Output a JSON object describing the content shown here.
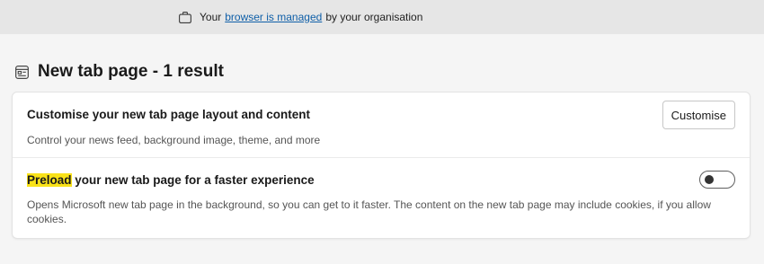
{
  "managed_bar": {
    "prefix": "Your",
    "link": "browser is managed",
    "suffix": "by your organisation",
    "icon": "briefcase-icon"
  },
  "section": {
    "title": "New tab page - 1 result",
    "icon": "new-tab-page-icon"
  },
  "settings": {
    "customise": {
      "title": "Customise your new tab page layout and content",
      "description": "Control your news feed, background image, theme, and more",
      "button_label": "Customise"
    },
    "preload": {
      "title_highlight": "Preload",
      "title_rest": " your new tab page for a faster experience",
      "description": "Opens Microsoft new tab page in the background, so you can get to it faster. The content on the new tab page may include cookies, if you allow cookies.",
      "enabled": false
    }
  },
  "colors": {
    "link": "#0f5fa8",
    "highlight": "#f9e21a"
  }
}
